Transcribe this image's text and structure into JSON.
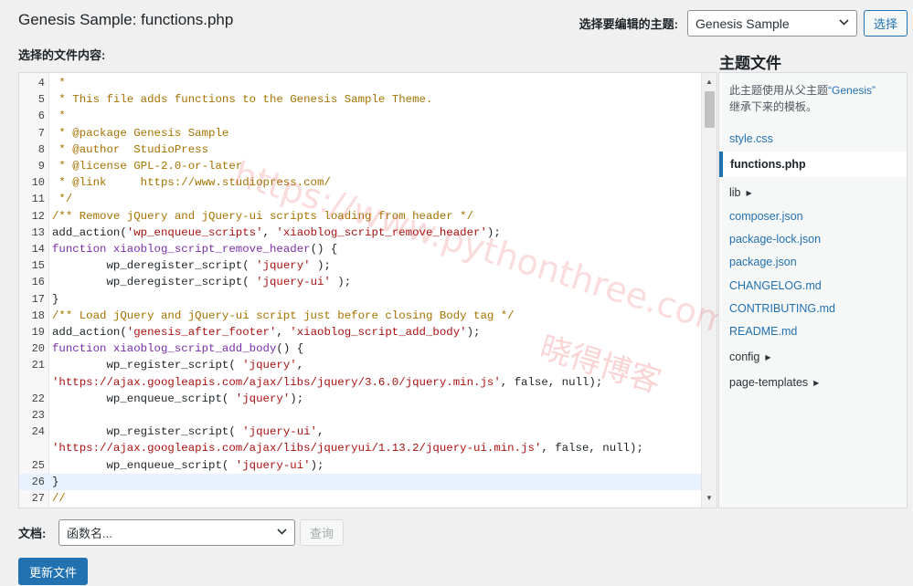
{
  "header": {
    "title": "Genesis Sample: functions.php",
    "theme_label": "选择要编辑的主题:",
    "theme_selected": "Genesis Sample",
    "select_button": "选择"
  },
  "editor": {
    "label": "选择的文件内容:",
    "lines": [
      {
        "n": "4",
        "segs": [
          {
            "t": " *",
            "c": "comment"
          }
        ]
      },
      {
        "n": "5",
        "segs": [
          {
            "t": " * This file adds functions to the Genesis Sample Theme.",
            "c": "comment"
          }
        ]
      },
      {
        "n": "6",
        "segs": [
          {
            "t": " *",
            "c": "comment"
          }
        ]
      },
      {
        "n": "7",
        "segs": [
          {
            "t": " * @package Genesis Sample",
            "c": "comment"
          }
        ]
      },
      {
        "n": "8",
        "segs": [
          {
            "t": " * @author  StudioPress",
            "c": "comment"
          }
        ]
      },
      {
        "n": "9",
        "segs": [
          {
            "t": " * @license GPL-2.0-or-later",
            "c": "comment"
          }
        ]
      },
      {
        "n": "10",
        "segs": [
          {
            "t": " * @link     https://www.studiopress.com/",
            "c": "comment"
          }
        ]
      },
      {
        "n": "11",
        "segs": [
          {
            "t": " */",
            "c": "comment"
          }
        ]
      },
      {
        "n": "12",
        "segs": [
          {
            "t": "/** Remove jQuery and jQuery-ui scripts loading from header */",
            "c": "comment"
          }
        ]
      },
      {
        "n": "13",
        "segs": [
          {
            "t": "add_action(",
            "c": "plain"
          },
          {
            "t": "'wp_enqueue_scripts'",
            "c": "string"
          },
          {
            "t": ", ",
            "c": "plain"
          },
          {
            "t": "'xiaoblog_script_remove_header'",
            "c": "string"
          },
          {
            "t": ");",
            "c": "plain"
          }
        ]
      },
      {
        "n": "14",
        "segs": [
          {
            "t": "function",
            "c": "keyword"
          },
          {
            "t": " xiaoblog_script_remove_header",
            "c": "keyword"
          },
          {
            "t": "() {",
            "c": "plain"
          }
        ]
      },
      {
        "n": "15",
        "segs": [
          {
            "t": "        wp_deregister_script( ",
            "c": "plain"
          },
          {
            "t": "'jquery'",
            "c": "string"
          },
          {
            "t": " );",
            "c": "plain"
          }
        ]
      },
      {
        "n": "16",
        "segs": [
          {
            "t": "        wp_deregister_script( ",
            "c": "plain"
          },
          {
            "t": "'jquery-ui'",
            "c": "string"
          },
          {
            "t": " );",
            "c": "plain"
          }
        ]
      },
      {
        "n": "17",
        "segs": [
          {
            "t": "}",
            "c": "plain"
          }
        ]
      },
      {
        "n": "18",
        "segs": [
          {
            "t": "/** Load jQuery and jQuery-ui script just before closing Body tag */",
            "c": "comment"
          }
        ]
      },
      {
        "n": "19",
        "segs": [
          {
            "t": "add_action(",
            "c": "plain"
          },
          {
            "t": "'genesis_after_footer'",
            "c": "string"
          },
          {
            "t": ", ",
            "c": "plain"
          },
          {
            "t": "'xiaoblog_script_add_body'",
            "c": "string"
          },
          {
            "t": ");",
            "c": "plain"
          }
        ]
      },
      {
        "n": "20",
        "segs": [
          {
            "t": "function",
            "c": "keyword"
          },
          {
            "t": " xiaoblog_script_add_body",
            "c": "keyword"
          },
          {
            "t": "() {",
            "c": "plain"
          }
        ]
      },
      {
        "n": "21",
        "segs": [
          {
            "t": "        wp_register_script( ",
            "c": "plain"
          },
          {
            "t": "'jquery'",
            "c": "string"
          },
          {
            "t": ",",
            "c": "plain"
          }
        ]
      },
      {
        "n": "",
        "segs": [
          {
            "t": "'https://ajax.googleapis.com/ajax/libs/jquery/3.6.0/jquery.min.js'",
            "c": "string"
          },
          {
            "t": ", false, null);",
            "c": "plain"
          }
        ]
      },
      {
        "n": "22",
        "segs": [
          {
            "t": "        wp_enqueue_script( ",
            "c": "plain"
          },
          {
            "t": "'jquery'",
            "c": "string"
          },
          {
            "t": ");",
            "c": "plain"
          }
        ]
      },
      {
        "n": "23",
        "segs": [
          {
            "t": "",
            "c": "plain"
          }
        ]
      },
      {
        "n": "24",
        "segs": [
          {
            "t": "        wp_register_script( ",
            "c": "plain"
          },
          {
            "t": "'jquery-ui'",
            "c": "string"
          },
          {
            "t": ",",
            "c": "plain"
          }
        ]
      },
      {
        "n": "",
        "segs": [
          {
            "t": "'https://ajax.googleapis.com/ajax/libs/jqueryui/1.13.2/jquery-ui.min.js'",
            "c": "string"
          },
          {
            "t": ", false, null);",
            "c": "plain"
          }
        ]
      },
      {
        "n": "25",
        "segs": [
          {
            "t": "        wp_enqueue_script( ",
            "c": "plain"
          },
          {
            "t": "'jquery-ui'",
            "c": "string"
          },
          {
            "t": ");",
            "c": "plain"
          }
        ]
      },
      {
        "n": "26",
        "segs": [
          {
            "t": "}",
            "c": "plain"
          }
        ],
        "active": true
      },
      {
        "n": "27",
        "segs": [
          {
            "t": "//",
            "c": "comment"
          }
        ]
      }
    ],
    "watermark_url": "https://www.pythonthree.com",
    "watermark_cn": "晓得博客"
  },
  "sidebar": {
    "title": "主题文件",
    "note_prefix": "此主题使用从父主题",
    "note_link": "“Genesis”",
    "note_suffix": "继承下来的模板。",
    "files": [
      {
        "label": "style.css",
        "kind": "file"
      },
      {
        "label": "functions.php",
        "kind": "current"
      },
      {
        "label": "lib",
        "kind": "folder"
      },
      {
        "label": "composer.json",
        "kind": "file"
      },
      {
        "label": "package-lock.json",
        "kind": "file"
      },
      {
        "label": "package.json",
        "kind": "file"
      },
      {
        "label": "CHANGELOG.md",
        "kind": "file"
      },
      {
        "label": "CONTRIBUTING.md",
        "kind": "file"
      },
      {
        "label": "README.md",
        "kind": "file"
      },
      {
        "label": "config",
        "kind": "folder"
      },
      {
        "label": "page-templates",
        "kind": "folder"
      }
    ]
  },
  "footer": {
    "doc_label": "文档:",
    "doc_placeholder": "函数名...",
    "lookup_button": "查询",
    "update_button": "更新文件"
  },
  "icons": {
    "dropdown": "chevron-down-icon",
    "folder_caret": "caret-right-icon",
    "scroll_up": "arrow-up-icon",
    "scroll_down": "arrow-down-icon"
  },
  "colors": {
    "accent": "#2271b1",
    "comment": "#a57200",
    "keyword": "#7a2ea8",
    "string": "#aa1111",
    "active_line": "#e8f2fe"
  }
}
